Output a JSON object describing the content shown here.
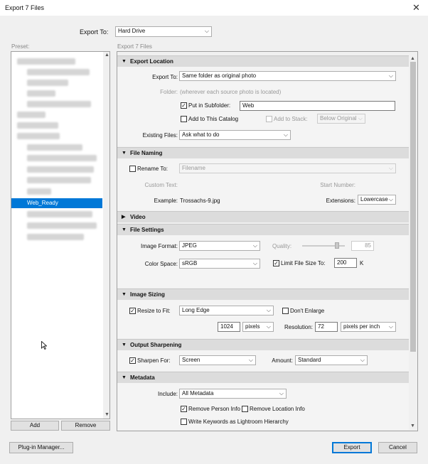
{
  "window": {
    "title": "Export 7 Files",
    "close_glyph": "✕"
  },
  "export_to": {
    "label": "Export To:",
    "value": "Hard Drive"
  },
  "preset_panel": {
    "label": "Preset:",
    "selected": "Web_Ready",
    "add_label": "Add",
    "remove_label": "Remove"
  },
  "main_header": "Export 7 Files",
  "export_location": {
    "title": "Export Location",
    "export_to_label": "Export To:",
    "export_to_value": "Same folder as original photo",
    "folder_label": "Folder:",
    "folder_value": "(wherever each source photo is located)",
    "put_in_subfolder_label": "Put in Subfolder:",
    "put_in_subfolder_checked": "✓",
    "subfolder_value": "Web",
    "add_to_catalog_label": "Add to This Catalog",
    "add_to_stack_label": "Add to Stack:",
    "stack_position": "Below Original",
    "existing_files_label": "Existing Files:",
    "existing_files_value": "Ask what to do"
  },
  "file_naming": {
    "title": "File Naming",
    "rename_to_label": "Rename To:",
    "rename_template": "Filename",
    "custom_text_label": "Custom Text:",
    "start_number_label": "Start Number:",
    "example_label": "Example:",
    "example_value": "Trossachs-9.jpg",
    "extensions_label": "Extensions:",
    "extensions_value": "Lowercase"
  },
  "video": {
    "title": "Video"
  },
  "file_settings": {
    "title": "File Settings",
    "image_format_label": "Image Format:",
    "image_format_value": "JPEG",
    "quality_label": "Quality:",
    "quality_value": "85",
    "quality_fraction": 0.85,
    "color_space_label": "Color Space:",
    "color_space_value": "sRGB",
    "limit_size_label": "Limit File Size To:",
    "limit_size_checked": "✓",
    "limit_size_value": "200",
    "limit_size_unit": "K"
  },
  "image_sizing": {
    "title": "Image Sizing",
    "resize_label": "Resize to Fit:",
    "resize_checked": "✓",
    "resize_mode": "Long Edge",
    "dont_enlarge_label": "Don't Enlarge",
    "size_value": "1024",
    "size_unit": "pixels",
    "resolution_label": "Resolution:",
    "resolution_value": "72",
    "resolution_unit": "pixels per inch"
  },
  "output_sharpening": {
    "title": "Output Sharpening",
    "sharpen_label": "Sharpen For:",
    "sharpen_checked": "✓",
    "sharpen_value": "Screen",
    "amount_label": "Amount:",
    "amount_value": "Standard"
  },
  "metadata": {
    "title": "Metadata",
    "include_label": "Include:",
    "include_value": "All Metadata",
    "remove_person_label": "Remove Person Info",
    "remove_person_checked": "✓",
    "remove_location_label": "Remove Location Info",
    "write_keywords_label": "Write Keywords as Lightroom Hierarchy"
  },
  "footer": {
    "plugin_manager_label": "Plug-in Manager...",
    "export_label": "Export",
    "cancel_label": "Cancel"
  },
  "icons": {
    "expanded": "▼",
    "collapsed": "▶",
    "dropdown": "⌵",
    "scroll_up": "▲",
    "scroll_down": "▼"
  }
}
